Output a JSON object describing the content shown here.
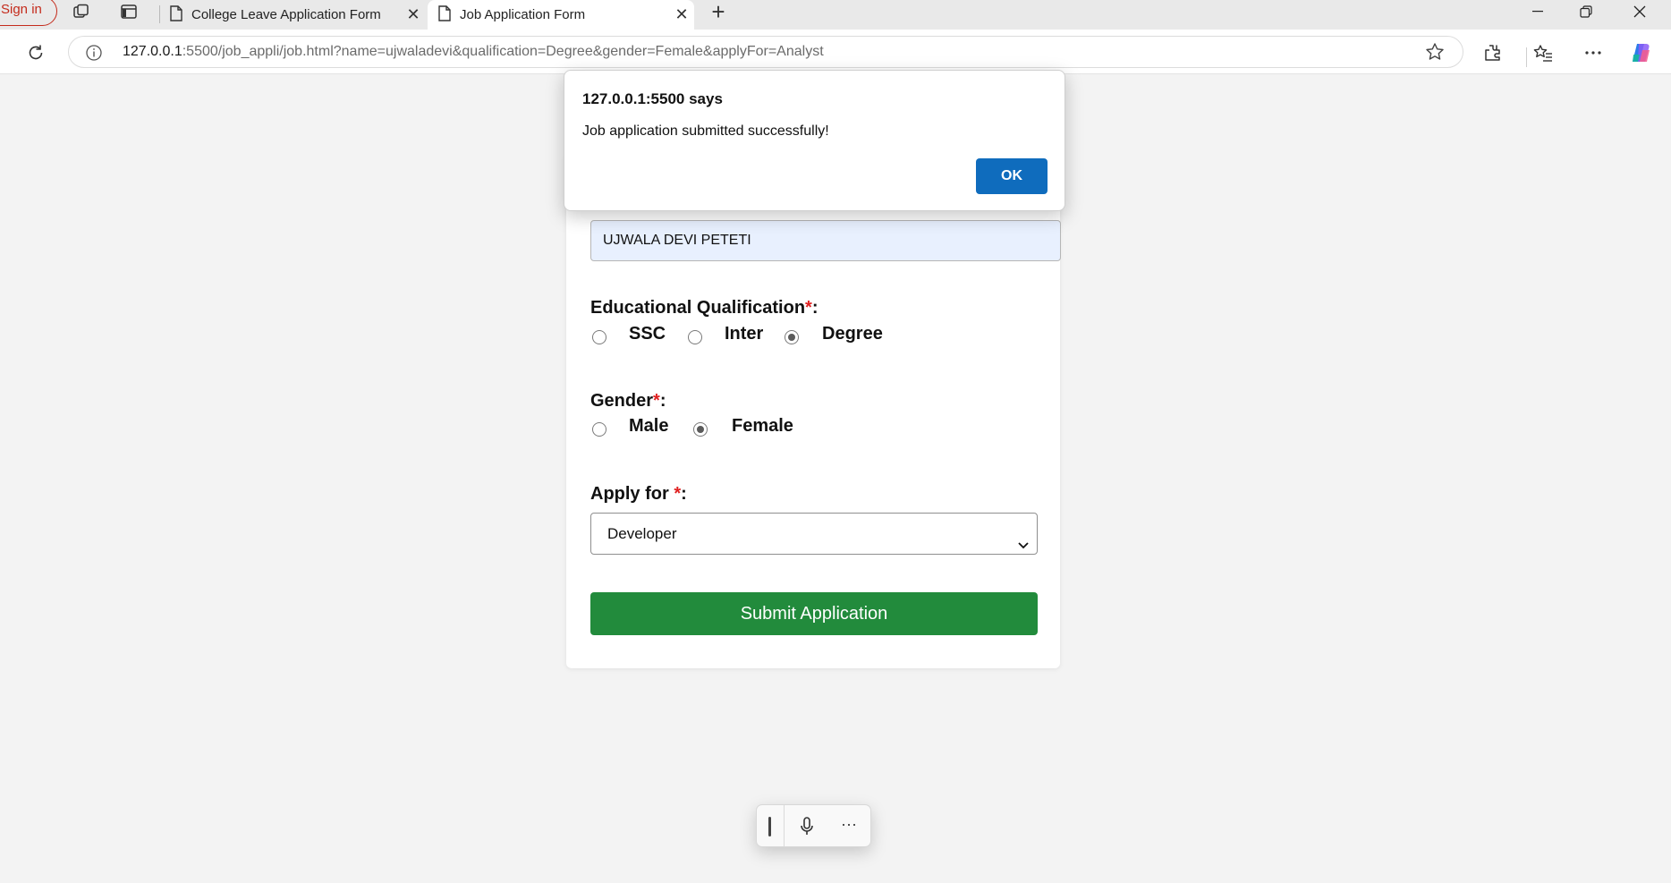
{
  "browser": {
    "signin_label": "Sign in",
    "tabs": [
      {
        "title": "College Leave Application Form"
      },
      {
        "title": "Job Application Form"
      }
    ],
    "address": {
      "host": "127.0.0.1",
      "rest": ":5500/job_appli/job.html?name=ujwaladevi&qualification=Degree&gender=Female&applyFor=Analyst"
    }
  },
  "form": {
    "name_value": "UJWALA DEVI PETETI",
    "qualification": {
      "label": "Educational Qualification",
      "required_mark": "*",
      "suffix": ":",
      "options": [
        "SSC",
        "Inter",
        "Degree"
      ],
      "selected": "Degree"
    },
    "gender": {
      "label": "Gender",
      "required_mark": "*",
      "suffix": ":",
      "options": [
        "Male",
        "Female"
      ],
      "selected": "Female"
    },
    "apply_for": {
      "label": "Apply for ",
      "required_mark": "*",
      "suffix": ":",
      "selected": "Developer"
    },
    "submit_label": "Submit Application"
  },
  "dialog": {
    "title": "127.0.0.1:5500 says",
    "message": "Job application submitted successfully!",
    "ok_label": "OK"
  },
  "voice_bar": {
    "more_label": "···"
  },
  "colors": {
    "accent_green": "#228b3c",
    "dialog_button_blue": "#0f6cbd",
    "required_red": "#e02020",
    "signin_red": "#c42b1c"
  }
}
